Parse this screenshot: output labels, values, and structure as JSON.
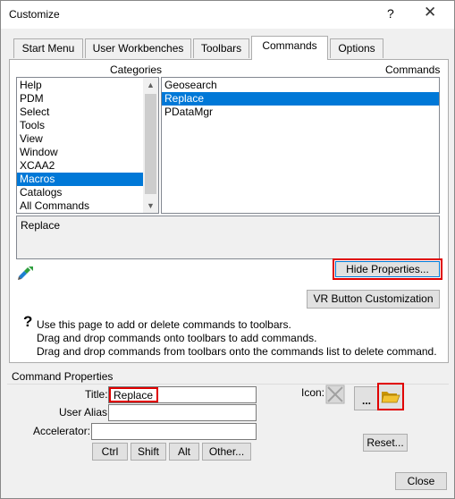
{
  "window": {
    "title": "Customize",
    "help_glyph": "?",
    "close_glyph": "✕"
  },
  "tabs": [
    {
      "label": "Start Menu"
    },
    {
      "label": "User Workbenches"
    },
    {
      "label": "Toolbars"
    },
    {
      "label": "Commands"
    },
    {
      "label": "Options"
    }
  ],
  "commands_tab": {
    "categories_label": "Categories",
    "commands_label": "Commands",
    "categories": [
      "Help",
      "PDM",
      "Select",
      "Tools",
      "View",
      "Window",
      "XCAA2",
      "Macros",
      "Catalogs",
      "All Commands"
    ],
    "selected_category": "Macros",
    "commands": [
      "Geosearch",
      "Replace",
      "PDataMgr"
    ],
    "selected_command": "Replace",
    "description": "Replace",
    "hide_properties_label": "Hide Properties...",
    "vr_button_label": "VR Button Customization",
    "help_lines": [
      "Use this page to add or delete commands to toolbars.",
      "Drag and drop commands onto toolbars to add commands.",
      "Drag and drop commands from toolbars onto the commands list to delete command."
    ]
  },
  "command_properties": {
    "group_label": "Command Properties",
    "title_label": "Title:",
    "title_value": "Replace",
    "user_alias_label": "User Alias:",
    "user_alias_value": "",
    "accelerator_label": "Accelerator:",
    "accelerator_value": "",
    "icon_label": "Icon:",
    "ellipsis_label": "...",
    "modifier_buttons": [
      "Ctrl",
      "Shift",
      "Alt",
      "Other..."
    ],
    "reset_label": "Reset..."
  },
  "footer": {
    "close_label": "Close"
  },
  "colors": {
    "selection": "#0078d7",
    "highlight_outline": "#e00000",
    "folder": "#e8b000"
  },
  "icons": {
    "help": "question-icon",
    "macro_recorder": "macro-icon",
    "no_icon": "empty-icon-placeholder",
    "folder": "open-folder-icon"
  }
}
